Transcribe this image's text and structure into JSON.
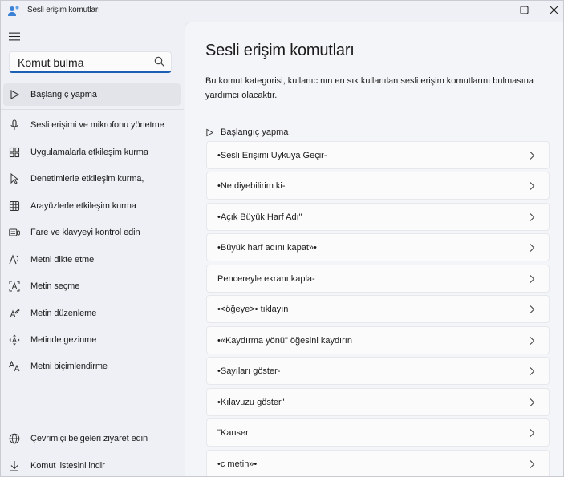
{
  "window": {
    "title": "Sesli erişim komutları"
  },
  "sidebar": {
    "search": {
      "value": "Komut bulma",
      "placeholder": "Komut bulma"
    },
    "items": [
      {
        "label": "Başlangıç yapma",
        "icon": "play-icon",
        "selected": true
      },
      {
        "label": "Sesli erişimi ve mikrofonu yönetme",
        "icon": "microphone-icon"
      },
      {
        "label": "Uygulamalarla etkileşim kurma",
        "icon": "apps-icon"
      },
      {
        "label": "Denetimlerle etkileşim kurma,",
        "icon": "cursor-icon"
      },
      {
        "label": "Arayüzlerle etkileşim kurma",
        "icon": "grid-icon"
      },
      {
        "label": "Fare ve klavyeyi kontrol edin",
        "icon": "keyboard-mouse-icon"
      },
      {
        "label": "Metni dikte etme",
        "icon": "dictate-icon"
      },
      {
        "label": "Metin seçme",
        "icon": "select-text-icon"
      },
      {
        "label": "Metin düzenleme",
        "icon": "edit-text-icon"
      },
      {
        "label": "Metinde gezinme",
        "icon": "navigate-text-icon"
      },
      {
        "label": "Metni biçimlendirme",
        "icon": "format-text-icon"
      }
    ],
    "footer": [
      {
        "label": "Çevrimiçi belgeleri ziyaret edin",
        "icon": "globe-icon"
      },
      {
        "label": "Komut listesini indir",
        "icon": "download-icon"
      }
    ]
  },
  "main": {
    "title": "Sesli erişim komutları",
    "description": "Bu komut kategorisi, kullanıcının en sık kullanılan sesli erişim komutlarını bulmasına yardımcı olacaktır.",
    "section": "Başlangıç yapma",
    "commands": [
      "•Sesli Erişimi Uykuya Geçir-",
      "•Ne diyebilirim ki-",
      "•Açık Büyük Harf Adı\"",
      "•Büyük harf adını kapat»•",
      "Pencereyle ekranı kapla-",
      "•<öğeye>• tıklayın",
      "•«Kaydırma yönü\" öğesini kaydırın",
      "•Sayıları göster-",
      "•Kılavuzu göster\"",
      "\"Kanser",
      "•c metin»•"
    ]
  },
  "colors": {
    "accent": "#1a5fb4",
    "selected_bg": "#e2e4ea",
    "app_icon": "#3b82d6"
  }
}
